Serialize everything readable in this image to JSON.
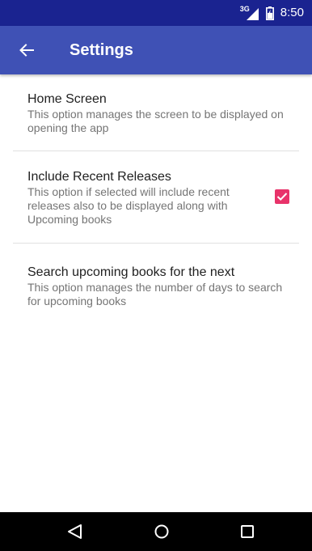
{
  "status_bar": {
    "network_label": "3G",
    "time": "8:50",
    "icons": [
      "signal-icon",
      "battery-icon"
    ]
  },
  "app_bar": {
    "back_icon": "arrow-left-icon",
    "title": "Settings"
  },
  "settings": [
    {
      "title": "Home Screen",
      "summary": "This option manages the screen to be displayed on opening the app"
    },
    {
      "title": "Include Recent Releases",
      "summary": "This option if selected will include recent releases also to be displayed along with Upcoming books",
      "checked": true
    },
    {
      "title": "Search upcoming books for the next",
      "summary": "This option manages the number of days to search for upcoming books"
    }
  ],
  "nav_bar": {
    "icons": [
      "back-triangle-icon",
      "home-circle-icon",
      "recents-square-icon"
    ]
  },
  "colors": {
    "status_bar": "#1a2390",
    "app_bar": "#3f51b5",
    "checkbox": "#e8336a",
    "nav_bar": "#000000"
  }
}
